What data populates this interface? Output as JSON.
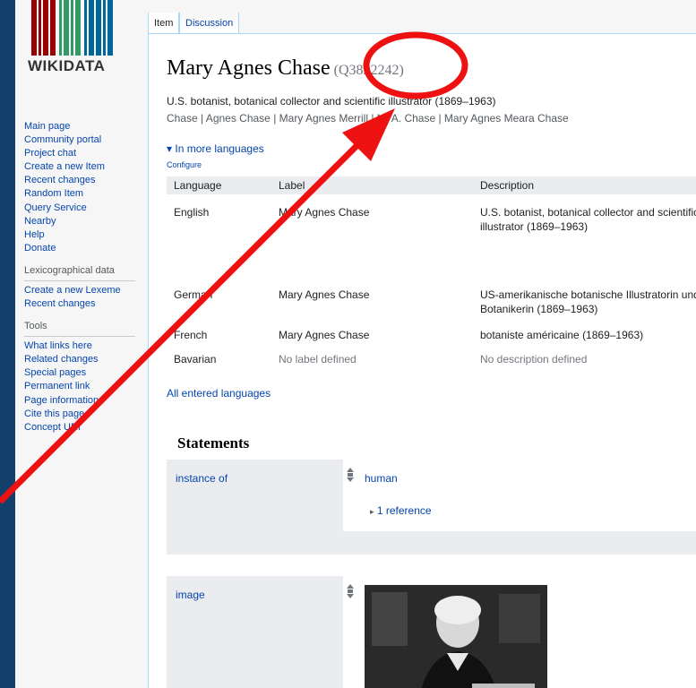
{
  "logo": {
    "wordmark": "WIKIDATA",
    "colors": [
      "#990000",
      "#339966",
      "#006699"
    ]
  },
  "nav": {
    "main": [
      "Main page",
      "Community portal",
      "Project chat",
      "Create a new Item",
      "Recent changes",
      "Random Item",
      "Query Service",
      "Nearby",
      "Help",
      "Donate"
    ],
    "lexeme_heading": "Lexicographical data",
    "lexeme": [
      "Create a new Lexeme",
      "Recent changes"
    ],
    "tools_heading": "Tools",
    "tools": [
      "What links here",
      "Related changes",
      "Special pages",
      "Permanent link",
      "Page information",
      "Cite this page",
      "Concept URI"
    ]
  },
  "tabs": {
    "item": "Item",
    "discussion": "Discussion"
  },
  "item": {
    "label": "Mary Agnes Chase",
    "qid": "(Q3822242)",
    "description": "U.S. botanist, botanical collector and scientific illustrator (1869–1963)",
    "aliases": "Chase | Agnes Chase | Mary Agnes Merrill | M. A. Chase | Mary Agnes Meara Chase"
  },
  "languages": {
    "toggle": "▾ In more languages",
    "configure": "Configure",
    "headers": {
      "language": "Language",
      "label": "Label",
      "description": "Description"
    },
    "rows": [
      {
        "language": "English",
        "label": "Mary Agnes Chase",
        "description": [
          "U.S. botanist, botanical collector and scientific",
          "illustrator (1869–1963)"
        ]
      },
      {
        "language": "German",
        "label": "Mary Agnes Chase",
        "description": [
          "US-amerikanische botanische Illustratorin und",
          "Botanikerin (1869–1963)"
        ]
      },
      {
        "language": "French",
        "label": "Mary Agnes Chase",
        "description": [
          "botaniste américaine (1869–1963)"
        ]
      },
      {
        "language": "Bavarian",
        "label": "No label defined",
        "description": [
          "No description defined"
        ]
      }
    ],
    "all_link": "All entered languages"
  },
  "statements": {
    "heading": "Statements",
    "instance_of": {
      "property": "instance of",
      "value": "human",
      "references": "1 reference",
      "ref_toggle": "▸"
    },
    "image": {
      "property": "image"
    }
  },
  "annotation": {
    "color": "#ee1111"
  }
}
